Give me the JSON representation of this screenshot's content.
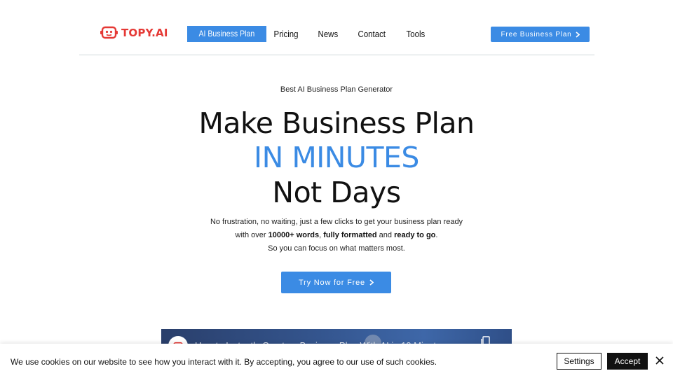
{
  "header": {
    "logo_text": "TOPY.AI",
    "nav": [
      {
        "label": "AI Business Plan",
        "active": true
      },
      {
        "label": "Pricing"
      },
      {
        "label": "News"
      },
      {
        "label": "Contact"
      },
      {
        "label": "Tools"
      }
    ],
    "cta_label": "Free Business Plan"
  },
  "hero": {
    "eyebrow": "Best AI Business Plan Generator",
    "headline_1": "Make Business Plan",
    "headline_2": "IN MINUTES",
    "headline_3": "Not Days",
    "sub_1": "No frustration, no waiting, just a few clicks to get your business plan ready",
    "sub_2_prefix": "with over ",
    "sub_2_words": "10000+ words",
    "sub_2_sep": ", ",
    "sub_2_formatted": "fully formatted",
    "sub_2_and": " and ",
    "sub_2_ready": "ready to go",
    "sub_2_end": ".",
    "sub_3": "So you can focus on what matters most.",
    "cta_label": "Try Now for Free"
  },
  "video": {
    "title": "How to Instantly Create a Business Plan With AI in 10 Minutes"
  },
  "cookie": {
    "text": "We use cookies on our website to see how you interact with it. By accepting, you agree to our use of such cookies.",
    "settings_label": "Settings",
    "accept_label": "Accept"
  },
  "colors": {
    "accent": "#3b8be4",
    "logo": "#e53935"
  },
  "icons": {
    "logo": "robot-face-icon",
    "chevron": "chevron-right-icon",
    "copy": "copy-link-icon",
    "close": "close-icon"
  }
}
